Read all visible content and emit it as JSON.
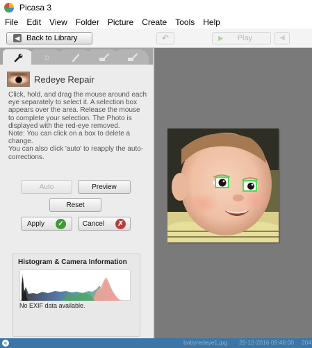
{
  "window": {
    "title": "Picasa 3"
  },
  "menu": [
    "File",
    "Edit",
    "View",
    "Folder",
    "Picture",
    "Create",
    "Tools",
    "Help"
  ],
  "toolbar": {
    "back_label": "Back to Library",
    "play_label": "Play"
  },
  "tabs": [
    "wrench-icon",
    "sun-icon",
    "brush-icon",
    "effects-brush-icon",
    "effects-brush-2-icon"
  ],
  "tool": {
    "title": "Redeye Repair",
    "instructions": [
      "Click, hold, and drag the mouse around each eye separately to select it. A selection box appears over the area.  Release the mouse to complete your selection. The Photo is displayed with the red-eye removed.",
      "Note: You can click on a box to delete a change.",
      "You can also click 'auto' to reapply the auto-corrections."
    ]
  },
  "buttons": {
    "auto": "Auto",
    "preview": "Preview",
    "reset": "Reset",
    "apply": "Apply",
    "cancel": "Cancel"
  },
  "histogram": {
    "title": "Histogram & Camera Information",
    "exif": "No EXIF data available."
  },
  "status": {
    "filename": "babyredeye1.jpg",
    "datetime": "29-12-2016 09:46:00",
    "size": "204"
  },
  "colors": {
    "accent": "#3b76a8",
    "selection": "#4fdd5a",
    "apply": "#3e9a33",
    "cancel": "#b73d3d"
  }
}
